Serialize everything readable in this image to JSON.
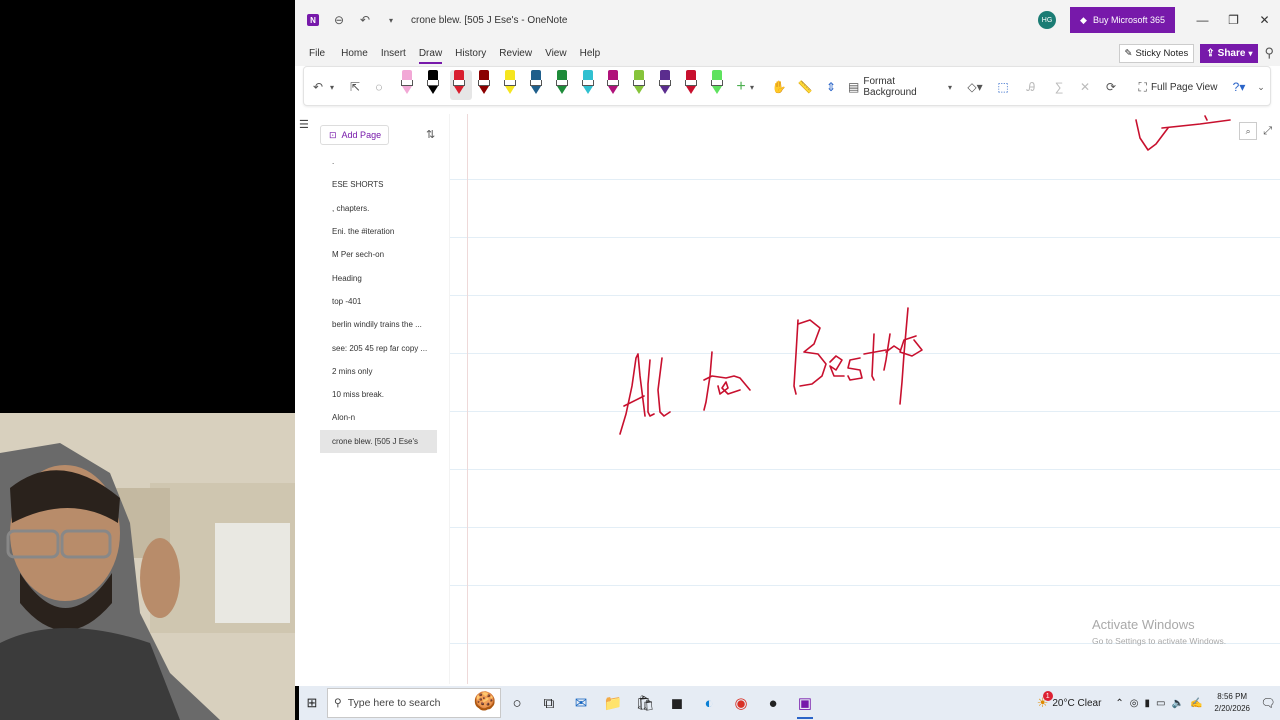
{
  "window": {
    "title": "crone blew. [505 J Ese's",
    "app_name": "OneNote",
    "avatar_initials": "HG",
    "buy_label": "Buy Microsoft 365",
    "accent": "#7719aa"
  },
  "menu": {
    "items": [
      "File",
      "Home",
      "Insert",
      "Draw",
      "History",
      "Review",
      "View",
      "Help"
    ],
    "active": "Draw",
    "sticky_notes": "Sticky Notes",
    "share": "Share"
  },
  "ribbon": {
    "pens": [
      "#f2a8d6",
      "#000000",
      "#d81e2e",
      "#8b0000",
      "#f5e51f",
      "#1f5f8b",
      "#1e8b3a",
      "#30c0d0",
      "#b0127a",
      "#86c43b",
      "#5b2d8e",
      "#c8102e",
      "#5ee25e"
    ],
    "format_background": "Format Background",
    "full_page_view": "Full Page View"
  },
  "nav": {
    "add_page": "Add Page",
    "pages": [
      ".",
      "ESE SHORTS",
      ", chapters.",
      "Eni. the #iteration",
      "M Per sech-on",
      "Heading",
      "top -401",
      "berlin windily trains the ...",
      "see: 205 45 rep far copy ...",
      "2 mins only",
      "10 miss break.",
      "Alon-n",
      "crone blew. [505 J Ese's"
    ],
    "selected_index": 12
  },
  "canvas": {
    "ink_color": "#c8102e",
    "handwriting": "All the Best"
  },
  "watermark": {
    "title": "Activate Windows",
    "subtitle": "Go to Settings to activate Windows."
  },
  "taskbar": {
    "search_placeholder": "Type here to search",
    "weather": "20°C  Clear",
    "weather_badge": "1",
    "time": "8:56 PM",
    "date": "2/20/2026"
  }
}
